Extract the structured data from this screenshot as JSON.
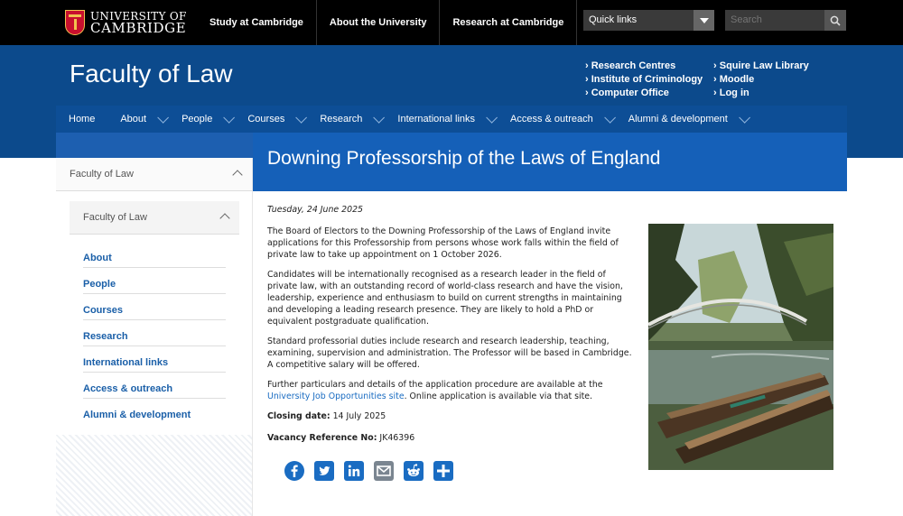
{
  "university": {
    "line1": "UNIVERSITY OF",
    "line2": "CAMBRIDGE"
  },
  "topnav": [
    {
      "label": "Study at Cambridge"
    },
    {
      "label": "About the University"
    },
    {
      "label": "Research at Cambridge"
    }
  ],
  "quicklinks": {
    "label": "Quick links"
  },
  "search": {
    "placeholder": "Search"
  },
  "header": {
    "title": "Faculty of Law",
    "utility_col1": [
      "Research Centres",
      "Institute of Criminology",
      "Computer Office"
    ],
    "utility_col2": [
      "Squire Law Library",
      "Moodle",
      "Log in"
    ]
  },
  "mainnav": [
    {
      "label": "Home"
    },
    {
      "label": "About"
    },
    {
      "label": "People"
    },
    {
      "label": "Courses"
    },
    {
      "label": "Research"
    },
    {
      "label": "International links"
    },
    {
      "label": "Access & outreach"
    },
    {
      "label": "Alumni & development"
    }
  ],
  "page": {
    "title": "Downing Professorship of the Laws of England",
    "date": "Tuesday, 24 June 2025",
    "para1": "The Board of Electors to the Downing Professorship of the Laws of England invite applications for this Professorship from persons whose work falls within the field of private law to take up appointment on 1 October 2026.",
    "para2": "Candidates will be internationally recognised as a research leader in the field of private law, with an outstanding record of world-class research and have the vision, leadership, experience and enthusiasm to build on current strengths in maintaining and developing a leading research presence. They are likely to hold a PhD or equivalent postgraduate qualification.",
    "para3": "Standard professorial duties include research and research leadership, teaching, examining, supervision and administration. The Professor will be based in Cambridge. A competitive salary will be offered.",
    "para4_before": "Further particulars and details of the application procedure are available at the ",
    "para4_link": "University Job Opportunities site",
    "para4_after": ".  Online application is available via that site.",
    "closing_label": "Closing date:",
    "closing_value": " 14 July 2025",
    "vacancy_label": "Vacancy Reference No:",
    "vacancy_value": " JK46396"
  },
  "sidebar": {
    "head": "Faculty of Law",
    "sub": "Faculty of Law",
    "items": [
      {
        "label": "About"
      },
      {
        "label": "People"
      },
      {
        "label": "Courses"
      },
      {
        "label": "Research"
      },
      {
        "label": "International links"
      },
      {
        "label": "Access & outreach"
      },
      {
        "label": "Alumni & development"
      }
    ]
  },
  "share": [
    {
      "icon": "facebook-icon",
      "color": "#1a6cc2"
    },
    {
      "icon": "twitter-icon",
      "color": "#1a6cc2"
    },
    {
      "icon": "linkedin-icon",
      "color": "#1a6cc2"
    },
    {
      "icon": "email-icon",
      "color": "#7a8590"
    },
    {
      "icon": "reddit-icon",
      "color": "#1a6cc2"
    },
    {
      "icon": "share-icon",
      "color": "#1a6cc2"
    }
  ]
}
